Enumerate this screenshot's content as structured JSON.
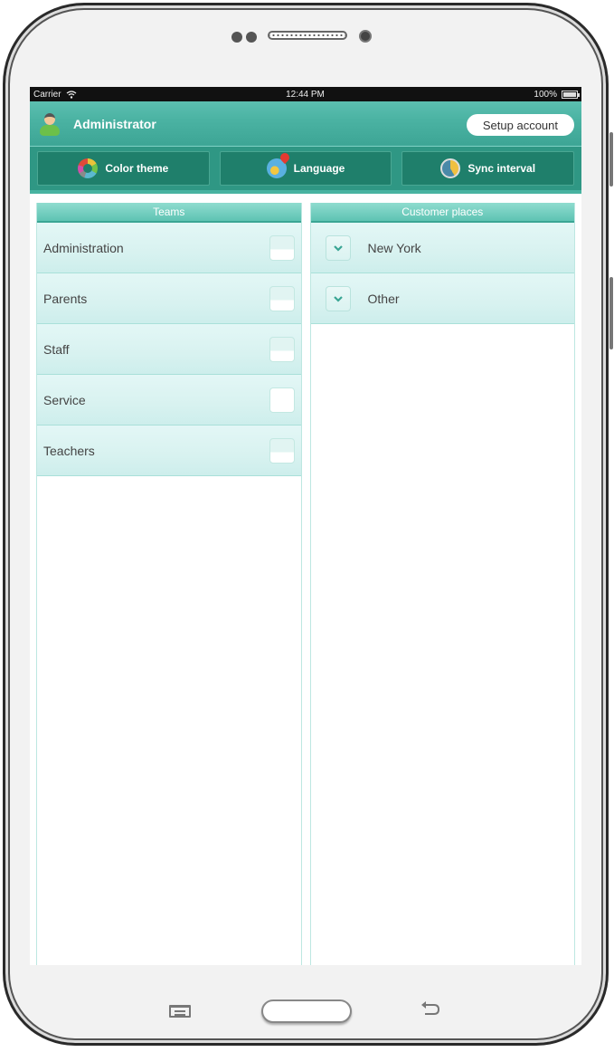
{
  "status_bar": {
    "carrier": "Carrier",
    "time": "12:44 PM",
    "battery": "100%"
  },
  "header": {
    "title": "Administrator",
    "setup_button": "Setup account"
  },
  "toolbar": {
    "buttons": [
      {
        "label": "Color theme",
        "icon": "color-wheel-icon"
      },
      {
        "label": "Language",
        "icon": "globe-pin-icon"
      },
      {
        "label": "Sync interval",
        "icon": "clock-icon"
      }
    ]
  },
  "teams": {
    "title": "Teams",
    "items": [
      {
        "label": "Administration",
        "checked": false
      },
      {
        "label": "Parents",
        "checked": false
      },
      {
        "label": "Staff",
        "checked": false
      },
      {
        "label": "Service",
        "checked": true
      },
      {
        "label": "Teachers",
        "checked": false
      }
    ]
  },
  "customer_places": {
    "title": "Customer places",
    "items": [
      {
        "label": "New York"
      },
      {
        "label": "Other"
      }
    ]
  },
  "colors": {
    "accent": "#3da595",
    "toolbar": "#1f7f6b",
    "row_bg": "#d8f2f0",
    "checked": "#5bc040"
  }
}
